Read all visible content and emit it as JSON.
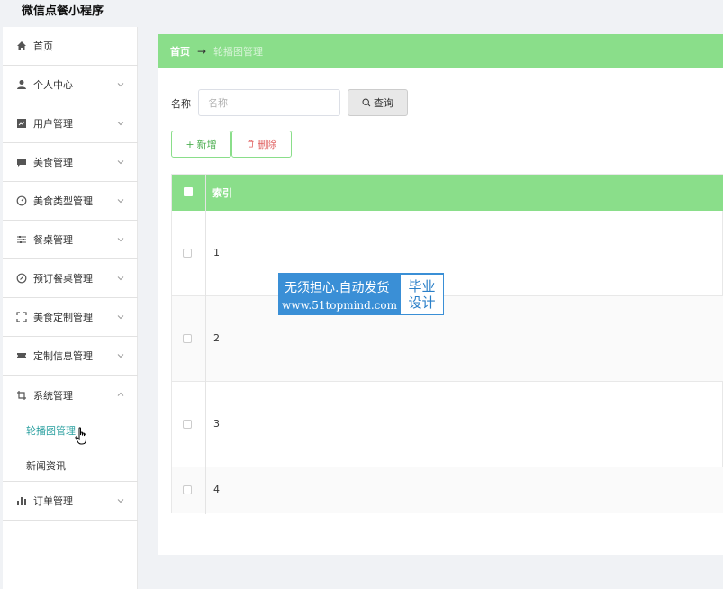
{
  "app": {
    "title": "微信点餐小程序"
  },
  "sidebar": {
    "items": [
      {
        "label": "首页",
        "icon": "home-icon"
      },
      {
        "label": "个人中心",
        "icon": "user-icon"
      },
      {
        "label": "用户管理",
        "icon": "chart-icon"
      },
      {
        "label": "美食管理",
        "icon": "message-icon"
      },
      {
        "label": "美食类型管理",
        "icon": "dashboard-icon"
      },
      {
        "label": "餐桌管理",
        "icon": "sliders-icon"
      },
      {
        "label": "预订餐桌管理",
        "icon": "compass-icon"
      },
      {
        "label": "美食定制管理",
        "icon": "fullscreen-icon"
      },
      {
        "label": "定制信息管理",
        "icon": "ticket-icon"
      },
      {
        "label": "系统管理",
        "icon": "crop-icon"
      }
    ],
    "sub_items": [
      {
        "label": "轮播图管理",
        "active": true
      },
      {
        "label": "新闻资讯",
        "active": false
      }
    ],
    "last_item": {
      "label": "订单管理",
      "icon": "bar-chart-icon"
    }
  },
  "breadcrumb": {
    "home": "首页",
    "separator": "→",
    "current": "轮播图管理"
  },
  "search": {
    "label": "名称",
    "placeholder": "名称",
    "value": "",
    "button": "查询"
  },
  "actions": {
    "add": "新增",
    "delete": "删除"
  },
  "table": {
    "columns": [
      "索引"
    ],
    "rows": [
      {
        "index": "1"
      },
      {
        "index": "2"
      },
      {
        "index": "3"
      },
      {
        "index": "4"
      }
    ]
  },
  "watermark": {
    "line1": "无须担心.自动发货",
    "line2": "www.51topmind.com",
    "badge_top": "毕业",
    "badge_bottom": "设计"
  },
  "colors": {
    "header_green": "#8ade8a",
    "active_teal": "#2aa0a0",
    "delete_red": "#e06060"
  }
}
